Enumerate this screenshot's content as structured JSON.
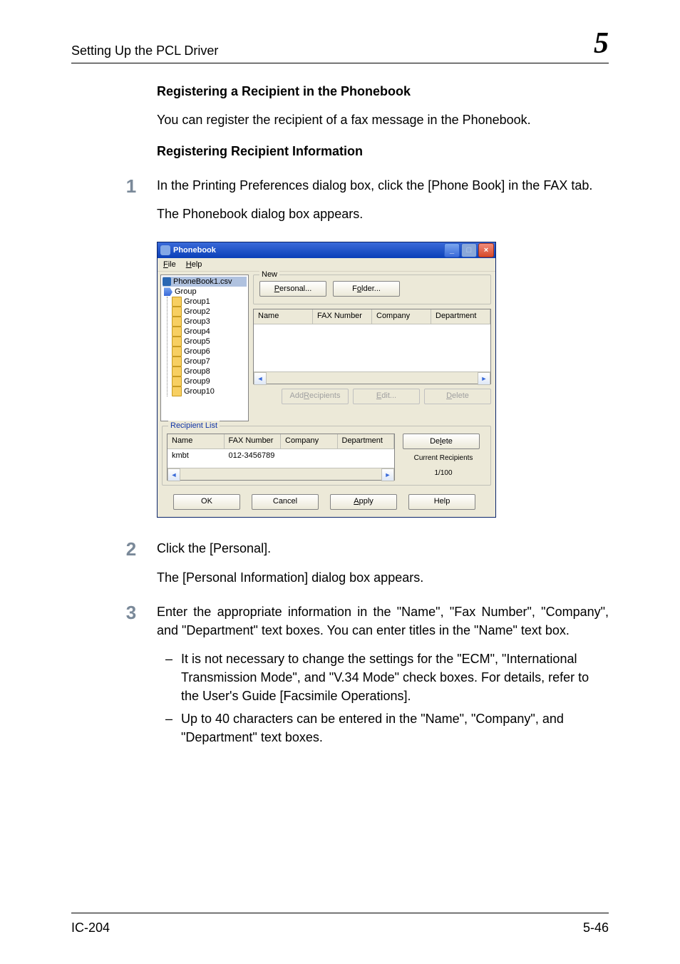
{
  "header": {
    "title": "Setting Up the PCL Driver",
    "chapter": "5"
  },
  "h_reg_recipient": "Registering a Recipient in the Phonebook",
  "p_intro": "You can register the recipient of a fax message in the Phonebook.",
  "h_reg_info": "Registering Recipient Information",
  "steps": {
    "s1": {
      "num": "1",
      "p1": "In the Printing Preferences dialog box, click the [Phone Book] in the FAX tab.",
      "p2": "The Phonebook dialog box appears."
    },
    "s2": {
      "num": "2",
      "p1": "Click the [Personal].",
      "p2": "The [Personal Information] dialog box appears."
    },
    "s3": {
      "num": "3",
      "p1": "Enter the appropriate information in the \"Name\", \"Fax Number\", \"Company\", and \"Department\" text boxes. You can enter titles in the \"Name\" text box.",
      "b1": "It is not necessary to change the settings for the \"ECM\", \"International Transmission Mode\", and \"V.34 Mode\" check boxes. For details, refer to the User's Guide [Facsimile Operations].",
      "b2": "Up to 40 characters can be entered in the \"Name\", \"Company\", and \"Department\" text boxes."
    }
  },
  "footer": {
    "left": "IC-204",
    "right": "5-46"
  },
  "dialog": {
    "title": "Phonebook",
    "menu": {
      "file": "File",
      "help": "Help"
    },
    "tree": {
      "root": "PhoneBook1.csv",
      "group": "Group",
      "items": [
        "Group1",
        "Group2",
        "Group3",
        "Group4",
        "Group5",
        "Group6",
        "Group7",
        "Group8",
        "Group9",
        "Group10"
      ]
    },
    "newbox": {
      "legend": "New",
      "personal": "Personal...",
      "folder": "Folder..."
    },
    "cols": {
      "name": "Name",
      "fax": "FAX Number",
      "company": "Company",
      "dept": "Department"
    },
    "actions": {
      "add": "Add Recipients",
      "edit": "Edit...",
      "delete": "Delete"
    },
    "reclist": {
      "legend": "Recipient List",
      "row": {
        "name": "kmbt",
        "fax": "012-3456789",
        "company": "",
        "dept": ""
      },
      "delete": "Delete",
      "cur_label": "Current Recipients",
      "cur_count": "1/100"
    },
    "buttons": {
      "ok": "OK",
      "cancel": "Cancel",
      "apply": "Apply",
      "help": "Help"
    }
  }
}
